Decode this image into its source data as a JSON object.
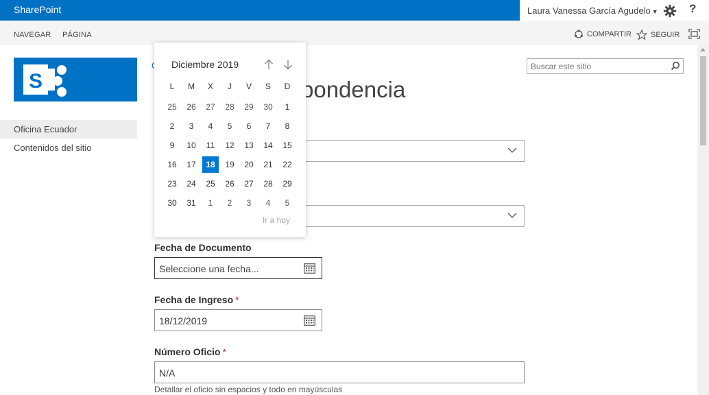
{
  "suite": {
    "brand": "SharePoint",
    "user_name": "Laura Vanessa García Agudelo",
    "help": "?"
  },
  "ribbon": {
    "tab_navigate": "NAVEGAR",
    "tab_page": "PÁGINA",
    "share": "COMPARTIR",
    "follow": "SEGUIR"
  },
  "nav": {
    "items": [
      {
        "label": "Oficina Ecuador"
      },
      {
        "label": "Contenidos del sitio"
      }
    ]
  },
  "search": {
    "placeholder": "Buscar este sitio"
  },
  "page": {
    "crumb_visible": "C",
    "title_visible": "pondencia"
  },
  "calendar": {
    "month_label": "Diciembre 2019",
    "dow": [
      "L",
      "M",
      "X",
      "J",
      "V",
      "S",
      "D"
    ],
    "weeks": [
      [
        "25",
        "26",
        "27",
        "28",
        "29",
        "30",
        "1"
      ],
      [
        "2",
        "3",
        "4",
        "5",
        "6",
        "7",
        "8"
      ],
      [
        "9",
        "10",
        "11",
        "12",
        "13",
        "14",
        "15"
      ],
      [
        "16",
        "17",
        "18",
        "19",
        "20",
        "21",
        "22"
      ],
      [
        "23",
        "24",
        "25",
        "26",
        "27",
        "28",
        "29"
      ],
      [
        "30",
        "31",
        "1",
        "2",
        "3",
        "4",
        "5"
      ]
    ],
    "selected_day": "18",
    "go_today": "Ir a hoy"
  },
  "form": {
    "fecha_documento": {
      "label": "Fecha de Documento",
      "placeholder": "Seleccione una fecha..."
    },
    "fecha_ingreso": {
      "label": "Fecha de Ingreso",
      "required": "*",
      "value": "18/12/2019"
    },
    "numero_oficio": {
      "label": "Número Oficio",
      "required": "*",
      "value": "N/A",
      "help": "Detallar el oficio sin espacios y todo en mayúsculas"
    }
  },
  "colors": {
    "brand_blue": "#0072c6",
    "selected_day": "#0078d4",
    "required_red": "#a4262c"
  }
}
